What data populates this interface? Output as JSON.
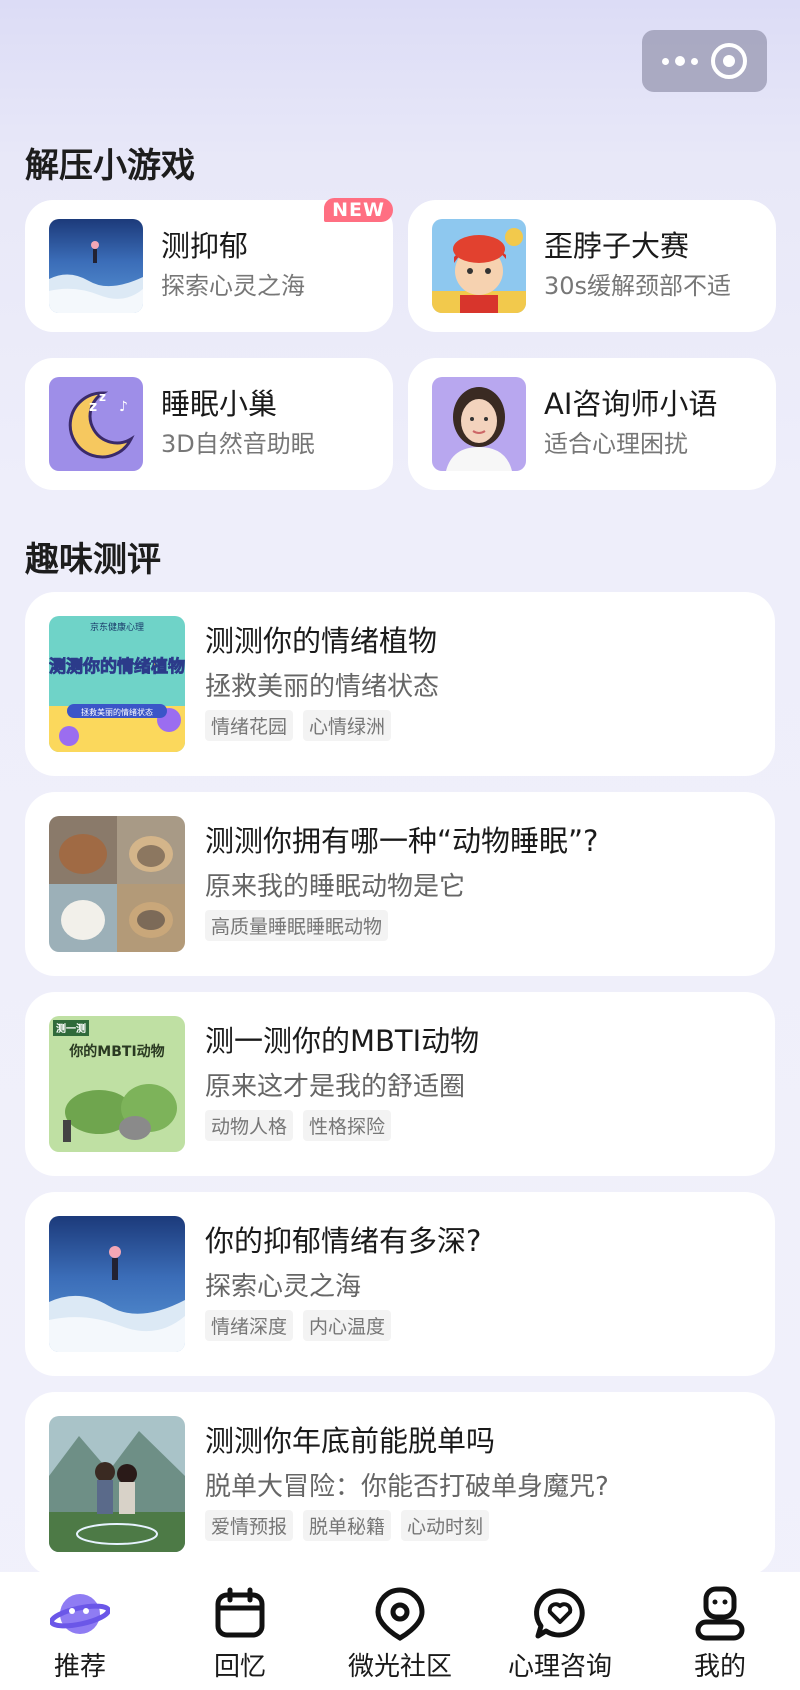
{
  "sections": {
    "games_title": "解压小游戏",
    "quiz_title": "趣味测评"
  },
  "games": [
    {
      "title": "测抑郁",
      "subtitle": "探索心灵之海",
      "badge": "NEW"
    },
    {
      "title": "歪脖子大赛",
      "subtitle": "30s缓解颈部不适"
    },
    {
      "title": "睡眠小巢",
      "subtitle": "3D自然音助眠"
    },
    {
      "title": "AI咨询师小语",
      "subtitle": "适合心理困扰"
    }
  ],
  "quizzes": [
    {
      "title": "测测你的情绪植物",
      "subtitle": "拯救美丽的情绪状态",
      "tags": [
        "情绪花园",
        "心情绿洲"
      ],
      "thumb_top": "京东健康心理",
      "thumb_main": "测测你的情绪植物",
      "thumb_foot": "拯救美丽的情绪状态"
    },
    {
      "title": "测测你拥有哪一种“动物睡眠”?",
      "subtitle": "原来我的睡眠动物是它",
      "tags": [
        "高质量睡眠睡眠动物"
      ]
    },
    {
      "title": "测一测你的MBTI动物",
      "subtitle": "原来这才是我的舒适圈",
      "tags": [
        "动物人格",
        "性格探险"
      ],
      "thumb_top": "测一测",
      "thumb_main": "你的MBTI动物"
    },
    {
      "title": "你的抑郁情绪有多深?",
      "subtitle": "探索心灵之海",
      "tags": [
        "情绪深度",
        "内心温度"
      ]
    },
    {
      "title": "测测你年底前能脱单吗",
      "subtitle": "脱单大冒险：你能否打破单身魔咒?",
      "tags": [
        "爱情预报",
        "脱单秘籍",
        "心动时刻"
      ]
    }
  ],
  "tabs": [
    {
      "label": "推荐",
      "icon": "planet-icon",
      "active": true
    },
    {
      "label": "回忆",
      "icon": "calendar-icon"
    },
    {
      "label": "微光社区",
      "icon": "location-pin-icon"
    },
    {
      "label": "心理咨询",
      "icon": "heart-chat-icon"
    },
    {
      "label": "我的",
      "icon": "profile-icon"
    }
  ],
  "colors": {
    "accent": "#7b6cf0",
    "badge": "#ff6f82"
  }
}
